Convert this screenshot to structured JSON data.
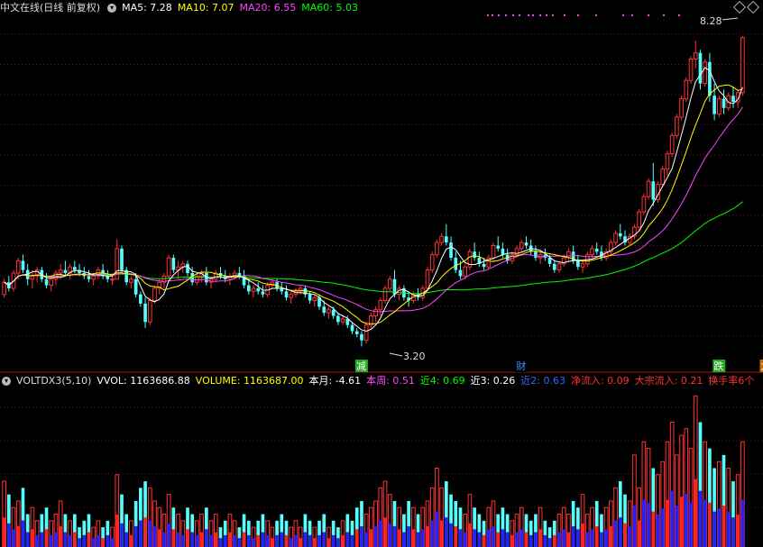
{
  "header": {
    "title": "中文在线(日线 前复权)",
    "ma": [
      {
        "label": "MA5: 7.28",
        "color": "#ffffff"
      },
      {
        "label": "MA10: 7.07",
        "color": "#ffff00"
      },
      {
        "label": "MA20: 6.55",
        "color": "#ff44ff"
      },
      {
        "label": "MA60: 5.03",
        "color": "#00ff00"
      }
    ]
  },
  "price_panel": {
    "high_label": "8.28",
    "low_label": "3.20",
    "markers": [
      {
        "text": "减",
        "bg": "#22aa22",
        "color": "#ffffff",
        "index": 76
      },
      {
        "text": "财",
        "bg": "#000000",
        "color": "#3399ff",
        "index": 110
      },
      {
        "text": "跌",
        "bg": "#22aa22",
        "color": "#ffffff",
        "index": 152
      },
      {
        "text": "龙虎",
        "bg": "#cc6600",
        "color": "#ffffff",
        "index": 162
      }
    ]
  },
  "volume_header": {
    "indicator": "VOLTDX3(5,10)",
    "items": [
      {
        "label": "VVOL: 1163686.88",
        "color": "#ffffff"
      },
      {
        "label": "VOLUME: 1163687.00",
        "color": "#ffff00"
      },
      {
        "label": "本月: -4.61",
        "color": "#ffffff"
      },
      {
        "label": "本周: 0.51",
        "color": "#ff44ff"
      },
      {
        "label": "近4: 0.69",
        "color": "#00ff00"
      },
      {
        "label": "近3: 0.26",
        "color": "#ffffff"
      },
      {
        "label": "近2: 0.63",
        "color": "#3366ff"
      },
      {
        "label": "净流入: 0.09",
        "color": "#ff3333"
      },
      {
        "label": "大宗流入: 0.21",
        "color": "#ff3333"
      },
      {
        "label": "换手率6个",
        "color": "#ff3333"
      }
    ]
  },
  "chart_data": {
    "type": "candlestick",
    "ylim": [
      3.0,
      8.6
    ],
    "colors": {
      "up": "#ff3333",
      "down": "#54ffff",
      "ma5": "#ffffff",
      "ma10": "#ffff00",
      "ma20": "#ff44ff",
      "ma60": "#00ff00",
      "vol_extra": "#2222ff"
    },
    "ohlc": [
      [
        4.05,
        4.3,
        4.0,
        4.25
      ],
      [
        4.25,
        4.35,
        4.1,
        4.15
      ],
      [
        4.15,
        4.45,
        4.1,
        4.4
      ],
      [
        4.4,
        4.65,
        4.3,
        4.6
      ],
      [
        4.6,
        4.7,
        4.4,
        4.45
      ],
      [
        4.45,
        4.55,
        4.2,
        4.3
      ],
      [
        4.3,
        4.45,
        4.15,
        4.35
      ],
      [
        4.35,
        4.5,
        4.25,
        4.45
      ],
      [
        4.45,
        4.5,
        4.25,
        4.3
      ],
      [
        4.3,
        4.4,
        4.15,
        4.2
      ],
      [
        4.2,
        4.35,
        4.1,
        4.3
      ],
      [
        4.3,
        4.45,
        4.2,
        4.4
      ],
      [
        4.4,
        4.55,
        4.3,
        4.45
      ],
      [
        4.45,
        4.6,
        4.35,
        4.4
      ],
      [
        4.4,
        4.55,
        4.3,
        4.5
      ],
      [
        4.5,
        4.6,
        4.4,
        4.45
      ],
      [
        4.45,
        4.55,
        4.35,
        4.4
      ],
      [
        4.4,
        4.5,
        4.3,
        4.35
      ],
      [
        4.35,
        4.45,
        4.25,
        4.3
      ],
      [
        4.3,
        4.4,
        4.2,
        4.35
      ],
      [
        4.35,
        4.5,
        4.3,
        4.45
      ],
      [
        4.45,
        4.55,
        4.3,
        4.35
      ],
      [
        4.35,
        4.45,
        4.25,
        4.3
      ],
      [
        4.3,
        4.4,
        4.2,
        4.3
      ],
      [
        4.3,
        4.95,
        4.3,
        4.8
      ],
      [
        4.8,
        4.85,
        4.4,
        4.45
      ],
      [
        4.45,
        4.5,
        4.2,
        4.25
      ],
      [
        4.25,
        4.35,
        4.15,
        4.3
      ],
      [
        4.3,
        4.4,
        4.0,
        4.05
      ],
      [
        4.05,
        4.1,
        3.85,
        3.9
      ],
      [
        3.9,
        4.0,
        3.5,
        3.6
      ],
      [
        3.6,
        4.0,
        3.55,
        3.95
      ],
      [
        3.95,
        4.2,
        3.9,
        4.15
      ],
      [
        4.15,
        4.3,
        4.05,
        4.25
      ],
      [
        4.25,
        4.4,
        4.15,
        4.35
      ],
      [
        4.35,
        4.7,
        4.3,
        4.65
      ],
      [
        4.65,
        4.7,
        4.4,
        4.45
      ],
      [
        4.45,
        4.6,
        4.3,
        4.5
      ],
      [
        4.5,
        4.6,
        4.4,
        4.55
      ],
      [
        4.55,
        4.6,
        4.35,
        4.4
      ],
      [
        4.4,
        4.5,
        4.2,
        4.25
      ],
      [
        4.25,
        4.4,
        4.2,
        4.35
      ],
      [
        4.35,
        4.45,
        4.25,
        4.4
      ],
      [
        4.4,
        4.5,
        4.2,
        4.25
      ],
      [
        4.25,
        4.35,
        4.15,
        4.3
      ],
      [
        4.3,
        4.45,
        4.25,
        4.4
      ],
      [
        4.4,
        4.5,
        4.3,
        4.35
      ],
      [
        4.35,
        4.45,
        4.25,
        4.3
      ],
      [
        4.3,
        4.4,
        4.2,
        4.35
      ],
      [
        4.35,
        4.45,
        4.3,
        4.4
      ],
      [
        4.4,
        4.5,
        4.3,
        4.35
      ],
      [
        4.35,
        4.45,
        4.15,
        4.2
      ],
      [
        4.2,
        4.3,
        4.05,
        4.1
      ],
      [
        4.1,
        4.2,
        4.0,
        4.15
      ],
      [
        4.15,
        4.25,
        4.05,
        4.1
      ],
      [
        4.1,
        4.2,
        4.0,
        4.05
      ],
      [
        4.05,
        4.25,
        4.0,
        4.2
      ],
      [
        4.2,
        4.3,
        4.15,
        4.25
      ],
      [
        4.25,
        4.3,
        4.1,
        4.15
      ],
      [
        4.15,
        4.25,
        4.05,
        4.1
      ],
      [
        4.1,
        4.2,
        3.95,
        4.0
      ],
      [
        4.0,
        4.1,
        3.9,
        4.05
      ],
      [
        4.05,
        4.15,
        4.0,
        4.1
      ],
      [
        4.1,
        4.2,
        4.05,
        4.15
      ],
      [
        4.15,
        4.2,
        4.0,
        4.05
      ],
      [
        4.05,
        4.1,
        3.9,
        3.95
      ],
      [
        3.95,
        4.05,
        3.85,
        4.0
      ],
      [
        4.0,
        4.05,
        3.8,
        3.85
      ],
      [
        3.85,
        3.95,
        3.7,
        3.75
      ],
      [
        3.75,
        3.85,
        3.65,
        3.8
      ],
      [
        3.8,
        3.85,
        3.65,
        3.7
      ],
      [
        3.7,
        3.75,
        3.55,
        3.6
      ],
      [
        3.6,
        3.7,
        3.55,
        3.65
      ],
      [
        3.65,
        3.7,
        3.5,
        3.55
      ],
      [
        3.55,
        3.6,
        3.4,
        3.45
      ],
      [
        3.45,
        3.5,
        3.35,
        3.4
      ],
      [
        3.4,
        3.45,
        3.2,
        3.3
      ],
      [
        3.3,
        3.6,
        3.25,
        3.55
      ],
      [
        3.55,
        3.75,
        3.5,
        3.7
      ],
      [
        3.7,
        3.85,
        3.6,
        3.8
      ],
      [
        3.8,
        4.0,
        3.7,
        3.95
      ],
      [
        3.95,
        4.2,
        3.9,
        4.15
      ],
      [
        4.15,
        4.35,
        4.1,
        4.3
      ],
      [
        4.3,
        4.45,
        4.0,
        4.05
      ],
      [
        4.05,
        4.2,
        3.95,
        4.15
      ],
      [
        4.15,
        4.2,
        3.95,
        4.0
      ],
      [
        4.0,
        4.1,
        3.85,
        3.95
      ],
      [
        3.95,
        4.1,
        3.9,
        4.05
      ],
      [
        4.05,
        4.15,
        3.95,
        4.0
      ],
      [
        4.0,
        4.2,
        3.95,
        4.15
      ],
      [
        4.15,
        4.5,
        4.1,
        4.45
      ],
      [
        4.45,
        4.75,
        4.4,
        4.7
      ],
      [
        4.7,
        4.95,
        4.65,
        4.9
      ],
      [
        4.9,
        5.05,
        4.85,
        5.0
      ],
      [
        5.0,
        5.2,
        4.85,
        4.9
      ],
      [
        4.9,
        5.0,
        4.6,
        4.65
      ],
      [
        4.65,
        4.75,
        4.4,
        4.45
      ],
      [
        4.45,
        4.6,
        4.3,
        4.35
      ],
      [
        4.35,
        4.55,
        4.3,
        4.5
      ],
      [
        4.5,
        4.8,
        4.45,
        4.75
      ],
      [
        4.75,
        4.9,
        4.6,
        4.65
      ],
      [
        4.65,
        4.75,
        4.5,
        4.55
      ],
      [
        4.55,
        4.65,
        4.45,
        4.5
      ],
      [
        4.5,
        4.7,
        4.45,
        4.65
      ],
      [
        4.65,
        4.9,
        4.6,
        4.85
      ],
      [
        4.85,
        5.0,
        4.75,
        4.8
      ],
      [
        4.8,
        4.9,
        4.65,
        4.7
      ],
      [
        4.7,
        4.8,
        4.55,
        4.6
      ],
      [
        4.6,
        4.75,
        4.55,
        4.7
      ],
      [
        4.7,
        4.85,
        4.65,
        4.8
      ],
      [
        4.8,
        4.95,
        4.75,
        4.9
      ],
      [
        4.9,
        5.0,
        4.8,
        4.85
      ],
      [
        4.85,
        4.95,
        4.7,
        4.75
      ],
      [
        4.75,
        4.85,
        4.6,
        4.65
      ],
      [
        4.65,
        4.75,
        4.55,
        4.7
      ],
      [
        4.7,
        4.8,
        4.6,
        4.65
      ],
      [
        4.65,
        4.7,
        4.5,
        4.55
      ],
      [
        4.55,
        4.6,
        4.4,
        4.45
      ],
      [
        4.45,
        4.6,
        4.4,
        4.55
      ],
      [
        4.55,
        4.7,
        4.5,
        4.65
      ],
      [
        4.65,
        4.8,
        4.6,
        4.75
      ],
      [
        4.75,
        4.85,
        4.55,
        4.6
      ],
      [
        4.6,
        4.7,
        4.45,
        4.5
      ],
      [
        4.5,
        4.6,
        4.4,
        4.55
      ],
      [
        4.55,
        4.75,
        4.5,
        4.7
      ],
      [
        4.7,
        4.85,
        4.65,
        4.8
      ],
      [
        4.8,
        4.9,
        4.7,
        4.75
      ],
      [
        4.75,
        4.85,
        4.6,
        4.65
      ],
      [
        4.65,
        4.8,
        4.6,
        4.75
      ],
      [
        4.75,
        4.95,
        4.7,
        4.9
      ],
      [
        4.9,
        5.1,
        4.85,
        5.05
      ],
      [
        5.05,
        5.2,
        4.95,
        5.0
      ],
      [
        5.0,
        5.1,
        4.85,
        4.9
      ],
      [
        4.9,
        5.05,
        4.85,
        5.0
      ],
      [
        5.0,
        5.2,
        4.95,
        5.15
      ],
      [
        5.15,
        5.45,
        5.1,
        5.4
      ],
      [
        5.4,
        5.7,
        5.35,
        5.65
      ],
      [
        5.65,
        5.95,
        5.6,
        5.9
      ],
      [
        5.9,
        6.2,
        5.5,
        5.6
      ],
      [
        5.6,
        5.9,
        5.55,
        5.85
      ],
      [
        5.85,
        6.15,
        5.8,
        6.1
      ],
      [
        6.1,
        6.4,
        6.0,
        6.35
      ],
      [
        6.35,
        6.7,
        6.3,
        6.65
      ],
      [
        6.65,
        7.0,
        6.6,
        6.95
      ],
      [
        6.95,
        7.3,
        6.9,
        7.25
      ],
      [
        7.25,
        7.6,
        7.2,
        7.55
      ],
      [
        7.55,
        7.95,
        7.5,
        7.9
      ],
      [
        7.9,
        8.2,
        7.75,
        8.0
      ],
      [
        8.0,
        8.05,
        7.4,
        7.5
      ],
      [
        7.5,
        7.9,
        7.45,
        7.85
      ],
      [
        7.85,
        8.0,
        7.2,
        7.3
      ],
      [
        7.3,
        7.5,
        6.9,
        7.0
      ],
      [
        7.0,
        7.3,
        6.95,
        7.25
      ],
      [
        7.25,
        7.4,
        7.0,
        7.1
      ],
      [
        7.1,
        7.35,
        7.05,
        7.3
      ],
      [
        7.3,
        7.45,
        7.1,
        7.2
      ],
      [
        7.2,
        7.4,
        7.1,
        7.35
      ],
      [
        7.35,
        8.28,
        7.3,
        8.25
      ]
    ],
    "volume": [
      1.0,
      0.8,
      0.6,
      0.7,
      0.9,
      0.5,
      0.6,
      0.4,
      0.5,
      0.6,
      0.4,
      0.5,
      0.7,
      0.5,
      0.4,
      0.5,
      0.3,
      0.4,
      0.5,
      0.3,
      0.4,
      0.3,
      0.4,
      0.3,
      1.1,
      0.8,
      0.5,
      0.4,
      0.7,
      0.9,
      1.0,
      0.9,
      0.7,
      0.6,
      0.5,
      0.8,
      0.6,
      0.5,
      0.4,
      0.6,
      0.5,
      0.4,
      0.5,
      0.6,
      0.4,
      0.5,
      0.3,
      0.4,
      0.5,
      0.4,
      0.3,
      0.5,
      0.4,
      0.3,
      0.4,
      0.5,
      0.4,
      0.3,
      0.4,
      0.5,
      0.4,
      0.3,
      0.4,
      0.3,
      0.5,
      0.4,
      0.3,
      0.4,
      0.5,
      0.3,
      0.4,
      0.3,
      0.4,
      0.5,
      0.4,
      0.6,
      0.7,
      0.5,
      0.6,
      0.7,
      0.9,
      1.0,
      0.8,
      0.7,
      0.6,
      0.5,
      0.7,
      0.6,
      0.5,
      0.6,
      0.7,
      0.9,
      1.2,
      0.9,
      1.0,
      0.8,
      0.7,
      0.6,
      0.5,
      0.8,
      0.6,
      0.5,
      0.4,
      0.6,
      0.7,
      0.5,
      0.6,
      0.5,
      0.4,
      0.5,
      0.6,
      0.5,
      0.4,
      0.5,
      0.6,
      0.4,
      0.3,
      0.4,
      0.5,
      0.6,
      0.5,
      0.7,
      0.6,
      0.8,
      0.5,
      0.6,
      0.7,
      0.5,
      0.6,
      0.7,
      0.9,
      1.0,
      0.8,
      0.7,
      1.4,
      0.9,
      1.6,
      1.5,
      1.2,
      1.1,
      1.3,
      1.6,
      1.9,
      1.4,
      1.7,
      1.8,
      1.5,
      2.3,
      1.9,
      1.6,
      1.5,
      1.2,
      1.3,
      1.4,
      1.2,
      1.0,
      1.1,
      1.6
    ],
    "vol_max": 2.4
  }
}
